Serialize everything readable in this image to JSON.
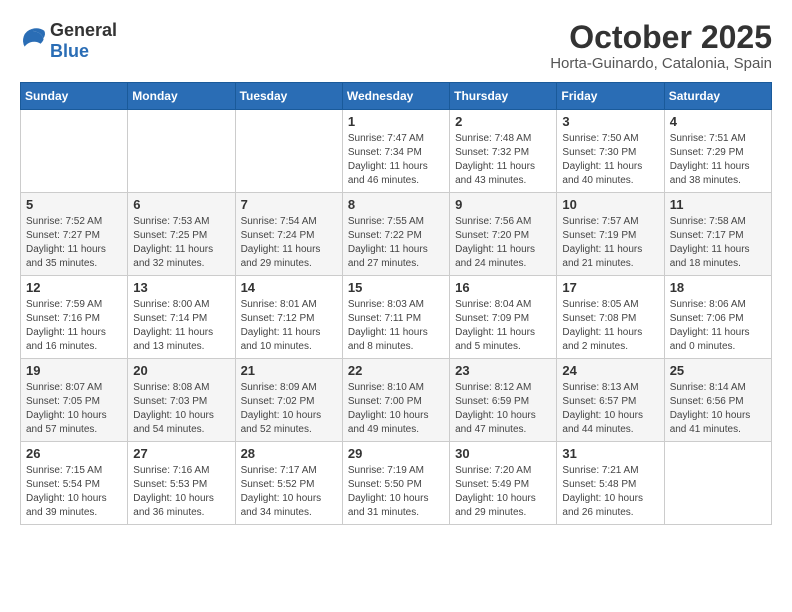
{
  "logo": {
    "text_general": "General",
    "text_blue": "Blue"
  },
  "title": {
    "month": "October 2025",
    "location": "Horta-Guinardo, Catalonia, Spain"
  },
  "weekdays": [
    "Sunday",
    "Monday",
    "Tuesday",
    "Wednesday",
    "Thursday",
    "Friday",
    "Saturday"
  ],
  "weeks": [
    [
      {
        "day": "",
        "sunrise": "",
        "sunset": "",
        "daylight": ""
      },
      {
        "day": "",
        "sunrise": "",
        "sunset": "",
        "daylight": ""
      },
      {
        "day": "",
        "sunrise": "",
        "sunset": "",
        "daylight": ""
      },
      {
        "day": "1",
        "sunrise": "Sunrise: 7:47 AM",
        "sunset": "Sunset: 7:34 PM",
        "daylight": "Daylight: 11 hours and 46 minutes."
      },
      {
        "day": "2",
        "sunrise": "Sunrise: 7:48 AM",
        "sunset": "Sunset: 7:32 PM",
        "daylight": "Daylight: 11 hours and 43 minutes."
      },
      {
        "day": "3",
        "sunrise": "Sunrise: 7:50 AM",
        "sunset": "Sunset: 7:30 PM",
        "daylight": "Daylight: 11 hours and 40 minutes."
      },
      {
        "day": "4",
        "sunrise": "Sunrise: 7:51 AM",
        "sunset": "Sunset: 7:29 PM",
        "daylight": "Daylight: 11 hours and 38 minutes."
      }
    ],
    [
      {
        "day": "5",
        "sunrise": "Sunrise: 7:52 AM",
        "sunset": "Sunset: 7:27 PM",
        "daylight": "Daylight: 11 hours and 35 minutes."
      },
      {
        "day": "6",
        "sunrise": "Sunrise: 7:53 AM",
        "sunset": "Sunset: 7:25 PM",
        "daylight": "Daylight: 11 hours and 32 minutes."
      },
      {
        "day": "7",
        "sunrise": "Sunrise: 7:54 AM",
        "sunset": "Sunset: 7:24 PM",
        "daylight": "Daylight: 11 hours and 29 minutes."
      },
      {
        "day": "8",
        "sunrise": "Sunrise: 7:55 AM",
        "sunset": "Sunset: 7:22 PM",
        "daylight": "Daylight: 11 hours and 27 minutes."
      },
      {
        "day": "9",
        "sunrise": "Sunrise: 7:56 AM",
        "sunset": "Sunset: 7:20 PM",
        "daylight": "Daylight: 11 hours and 24 minutes."
      },
      {
        "day": "10",
        "sunrise": "Sunrise: 7:57 AM",
        "sunset": "Sunset: 7:19 PM",
        "daylight": "Daylight: 11 hours and 21 minutes."
      },
      {
        "day": "11",
        "sunrise": "Sunrise: 7:58 AM",
        "sunset": "Sunset: 7:17 PM",
        "daylight": "Daylight: 11 hours and 18 minutes."
      }
    ],
    [
      {
        "day": "12",
        "sunrise": "Sunrise: 7:59 AM",
        "sunset": "Sunset: 7:16 PM",
        "daylight": "Daylight: 11 hours and 16 minutes."
      },
      {
        "day": "13",
        "sunrise": "Sunrise: 8:00 AM",
        "sunset": "Sunset: 7:14 PM",
        "daylight": "Daylight: 11 hours and 13 minutes."
      },
      {
        "day": "14",
        "sunrise": "Sunrise: 8:01 AM",
        "sunset": "Sunset: 7:12 PM",
        "daylight": "Daylight: 11 hours and 10 minutes."
      },
      {
        "day": "15",
        "sunrise": "Sunrise: 8:03 AM",
        "sunset": "Sunset: 7:11 PM",
        "daylight": "Daylight: 11 hours and 8 minutes."
      },
      {
        "day": "16",
        "sunrise": "Sunrise: 8:04 AM",
        "sunset": "Sunset: 7:09 PM",
        "daylight": "Daylight: 11 hours and 5 minutes."
      },
      {
        "day": "17",
        "sunrise": "Sunrise: 8:05 AM",
        "sunset": "Sunset: 7:08 PM",
        "daylight": "Daylight: 11 hours and 2 minutes."
      },
      {
        "day": "18",
        "sunrise": "Sunrise: 8:06 AM",
        "sunset": "Sunset: 7:06 PM",
        "daylight": "Daylight: 11 hours and 0 minutes."
      }
    ],
    [
      {
        "day": "19",
        "sunrise": "Sunrise: 8:07 AM",
        "sunset": "Sunset: 7:05 PM",
        "daylight": "Daylight: 10 hours and 57 minutes."
      },
      {
        "day": "20",
        "sunrise": "Sunrise: 8:08 AM",
        "sunset": "Sunset: 7:03 PM",
        "daylight": "Daylight: 10 hours and 54 minutes."
      },
      {
        "day": "21",
        "sunrise": "Sunrise: 8:09 AM",
        "sunset": "Sunset: 7:02 PM",
        "daylight": "Daylight: 10 hours and 52 minutes."
      },
      {
        "day": "22",
        "sunrise": "Sunrise: 8:10 AM",
        "sunset": "Sunset: 7:00 PM",
        "daylight": "Daylight: 10 hours and 49 minutes."
      },
      {
        "day": "23",
        "sunrise": "Sunrise: 8:12 AM",
        "sunset": "Sunset: 6:59 PM",
        "daylight": "Daylight: 10 hours and 47 minutes."
      },
      {
        "day": "24",
        "sunrise": "Sunrise: 8:13 AM",
        "sunset": "Sunset: 6:57 PM",
        "daylight": "Daylight: 10 hours and 44 minutes."
      },
      {
        "day": "25",
        "sunrise": "Sunrise: 8:14 AM",
        "sunset": "Sunset: 6:56 PM",
        "daylight": "Daylight: 10 hours and 41 minutes."
      }
    ],
    [
      {
        "day": "26",
        "sunrise": "Sunrise: 7:15 AM",
        "sunset": "Sunset: 5:54 PM",
        "daylight": "Daylight: 10 hours and 39 minutes."
      },
      {
        "day": "27",
        "sunrise": "Sunrise: 7:16 AM",
        "sunset": "Sunset: 5:53 PM",
        "daylight": "Daylight: 10 hours and 36 minutes."
      },
      {
        "day": "28",
        "sunrise": "Sunrise: 7:17 AM",
        "sunset": "Sunset: 5:52 PM",
        "daylight": "Daylight: 10 hours and 34 minutes."
      },
      {
        "day": "29",
        "sunrise": "Sunrise: 7:19 AM",
        "sunset": "Sunset: 5:50 PM",
        "daylight": "Daylight: 10 hours and 31 minutes."
      },
      {
        "day": "30",
        "sunrise": "Sunrise: 7:20 AM",
        "sunset": "Sunset: 5:49 PM",
        "daylight": "Daylight: 10 hours and 29 minutes."
      },
      {
        "day": "31",
        "sunrise": "Sunrise: 7:21 AM",
        "sunset": "Sunset: 5:48 PM",
        "daylight": "Daylight: 10 hours and 26 minutes."
      },
      {
        "day": "",
        "sunrise": "",
        "sunset": "",
        "daylight": ""
      }
    ]
  ]
}
